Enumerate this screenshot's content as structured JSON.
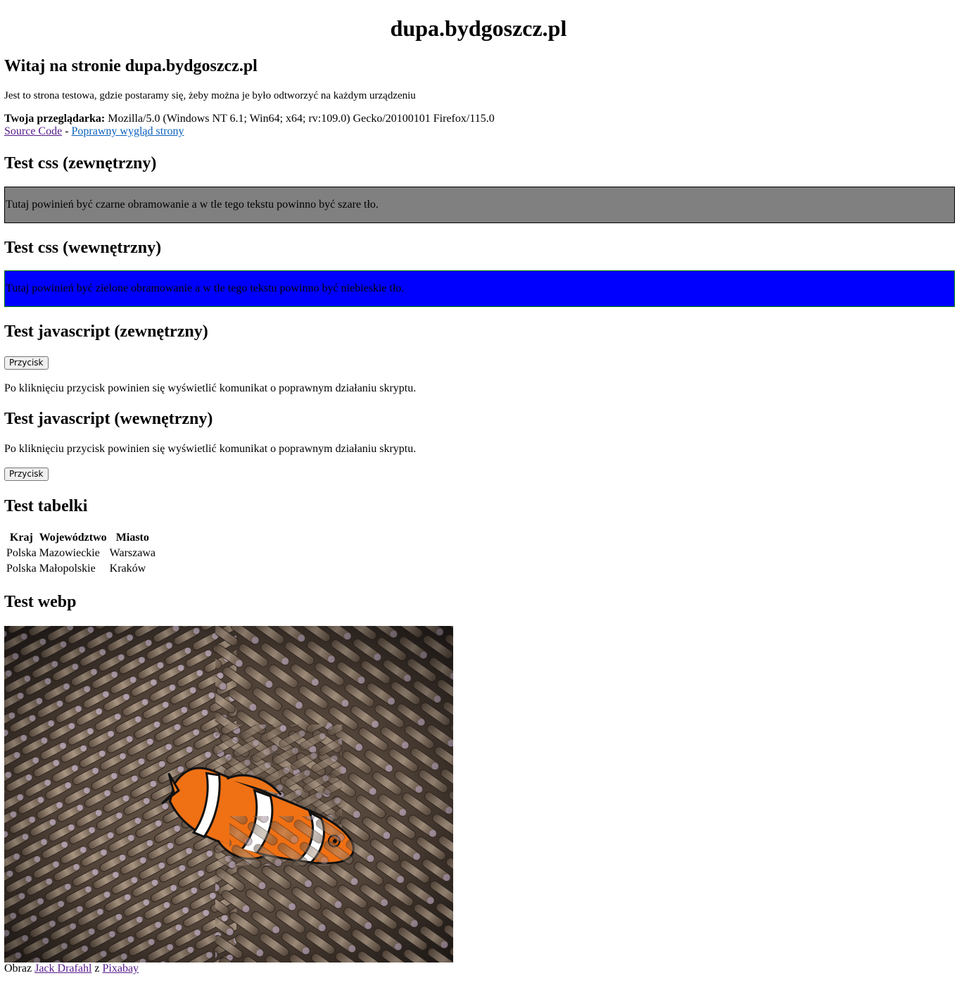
{
  "site_title": "dupa.bydgoszcz.pl",
  "welcome": {
    "heading": "Witaj na stronie dupa.bydgoszcz.pl",
    "intro": "Jest to strona testowa, gdzie postaramy się, żeby można je było odtworzyć na każdym urządzeniu",
    "browser_label": "Twoja przeglądarka:",
    "browser_value": "Mozilla/5.0 (Windows NT 6.1; Win64; x64; rv:109.0) Gecko/20100101 Firefox/115.0",
    "source_link": "Source Code",
    "separator": "-",
    "correct_view_link": "Poprawny wygląd strony"
  },
  "css_external": {
    "heading": "Test css (zewnętrzny)",
    "text": "Tutaj powinień być czarne obramowanie a w tle tego tekstu powinno być szare tło.",
    "bg_color": "#808080",
    "border_color": "#000000"
  },
  "css_internal": {
    "heading": "Test css (wewnętrzny)",
    "text": "Tutaj powinień być zielone obramowanie a w tle tego tekstu powinno być niebieskie tło.",
    "bg_color": "#0000ff",
    "border_color": "#008000"
  },
  "js_external": {
    "heading": "Test javascript (zewnętrzny)",
    "button_label": "Przycisk",
    "description": "Po kliknięciu przycisk powinien się wyświetlić komunikat o poprawnym działaniu skryptu."
  },
  "js_internal": {
    "heading": "Test javascript (wewnętrzny)",
    "description": "Po kliknięciu przycisk powinien się wyświetlić komunikat o poprawnym działaniu skryptu.",
    "button_label": "Przycisk"
  },
  "table_test": {
    "heading": "Test tabelki",
    "headers": [
      "Kraj",
      "Województwo",
      "Miasto"
    ],
    "rows": [
      [
        "Polska",
        "Mazowieckie",
        "Warszawa"
      ],
      [
        "Polska",
        "Małopolskie",
        "Kraków"
      ]
    ]
  },
  "webp_test": {
    "heading": "Test webp",
    "image_icon": "clownfish-in-anemone-photo",
    "credit_prefix": "Obraz",
    "credit_author": "Jack Drafahl",
    "credit_mid": "z",
    "credit_source": "Pixabay"
  },
  "colors": {
    "link_visited": "#551a8b",
    "link_unvisited": "#0b61bd"
  }
}
